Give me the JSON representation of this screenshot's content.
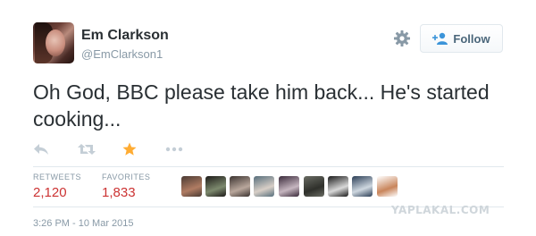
{
  "author": {
    "name": "Em Clarkson",
    "handle": "@EmClarkson1"
  },
  "follow_button": {
    "label": "Follow"
  },
  "tweet": {
    "text": "Oh God, BBC please take him back... He's started cooking..."
  },
  "actions": [
    {
      "icon": "reply-icon",
      "color": "#c4ced6"
    },
    {
      "icon": "retweet-icon",
      "color": "#c4ced6"
    },
    {
      "icon": "star-icon",
      "color": "#ffac33",
      "active": true
    },
    {
      "icon": "more-icon",
      "color": "#c4ced6"
    }
  ],
  "stats": {
    "retweets": {
      "label": "RETWEETS",
      "value": "2,120"
    },
    "favorites": {
      "label": "FAVORITES",
      "value": "1,833"
    }
  },
  "favoriters": [
    {
      "colors": [
        "#4a3a33",
        "#b07c63"
      ]
    },
    {
      "colors": [
        "#1d1a18",
        "#7d8a6e"
      ]
    },
    {
      "colors": [
        "#3b3330",
        "#b9a79c"
      ]
    },
    {
      "colors": [
        "#566e7b",
        "#d8cfc7"
      ]
    },
    {
      "colors": [
        "#3a2a3a",
        "#c6b6c0"
      ]
    },
    {
      "colors": [
        "#6a6c64",
        "#2f302b"
      ]
    },
    {
      "colors": [
        "#1a1a1a",
        "#d9d9d9"
      ]
    },
    {
      "colors": [
        "#2a3d55",
        "#cfd8e0"
      ]
    },
    {
      "colors": [
        "#ffffff",
        "#c9855b"
      ]
    }
  ],
  "timestamp": "3:26 PM - 10 Mar 2015",
  "watermark": "YAPLAKAL.COM",
  "colors": {
    "name": "#292f33",
    "muted": "#8899a6",
    "stat_value": "#cc3333",
    "follow_text": "#4a667a"
  }
}
